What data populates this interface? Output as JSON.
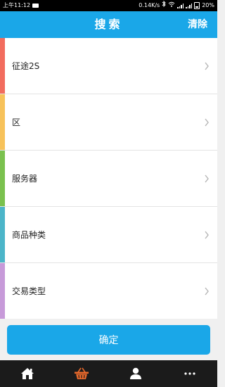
{
  "status_bar": {
    "time": "上午11:12",
    "net_speed": "0.14K/s",
    "battery": "20%"
  },
  "header": {
    "title": "搜索",
    "clear_label": "清除"
  },
  "filters": [
    {
      "label": "征途2S",
      "accent": "#f26c5e"
    },
    {
      "label": "区",
      "accent": "#f7c25a"
    },
    {
      "label": "服务器",
      "accent": "#7ac14e"
    },
    {
      "label": "商品种类",
      "accent": "#4cb5c9"
    },
    {
      "label": "交易类型",
      "accent": "#c79ad9"
    }
  ],
  "confirm_label": "确定",
  "bottom_nav": [
    {
      "icon": "home-icon"
    },
    {
      "icon": "basket-icon",
      "active_color": "#e8692b"
    },
    {
      "icon": "user-icon"
    },
    {
      "icon": "more-icon"
    }
  ],
  "colors": {
    "primary": "#1aa7e8",
    "nav_bg": "#1b1b1b"
  }
}
